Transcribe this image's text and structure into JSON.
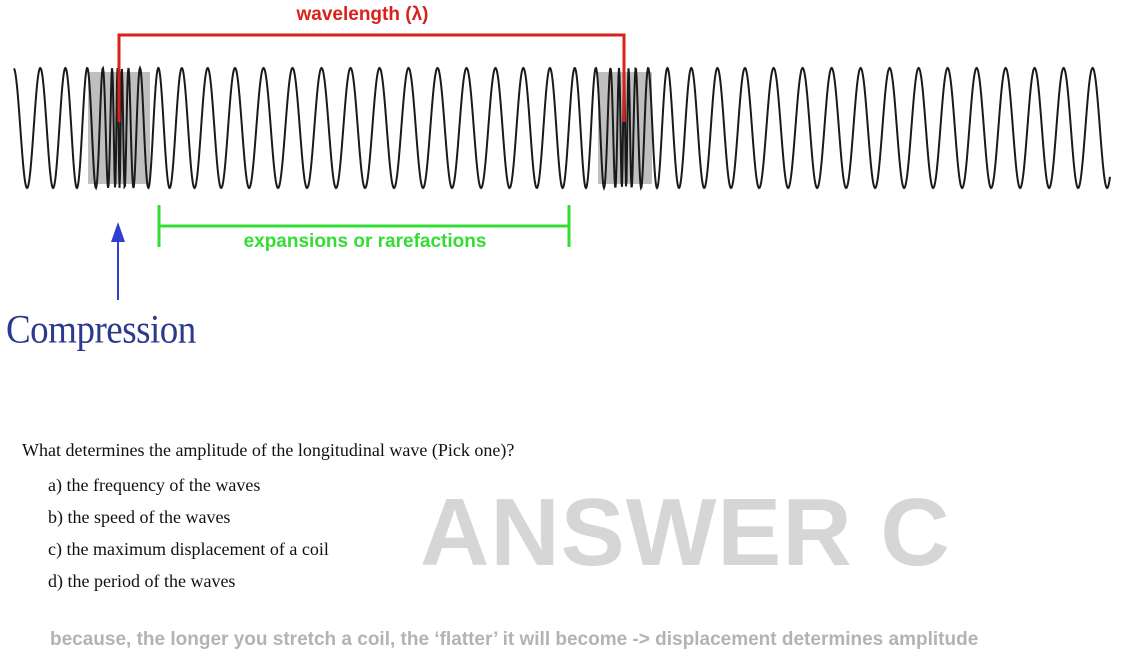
{
  "diagram": {
    "wavelength_label": "wavelength (λ)",
    "expansion_label": "expansions or rarefactions",
    "compression_label": "Compression",
    "colors": {
      "wave": "#1a1a1a",
      "compression_band": "#8a8a8a",
      "wavelength_bracket": "#d9211c",
      "expansion_bracket": "#33dd33",
      "compression_arrow": "#2f3fd0"
    }
  },
  "quiz": {
    "question": "What determines the amplitude of the longitudinal wave (Pick one)?",
    "options": [
      "a) the frequency of the waves",
      "b) the speed of the waves",
      "c) the maximum displacement of a coil",
      "d) the period of the waves"
    ],
    "answer_watermark": "ANSWER C",
    "explanation": "because, the longer you stretch a coil, the ‘flatter’ it will become -> displacement determines amplitude"
  }
}
